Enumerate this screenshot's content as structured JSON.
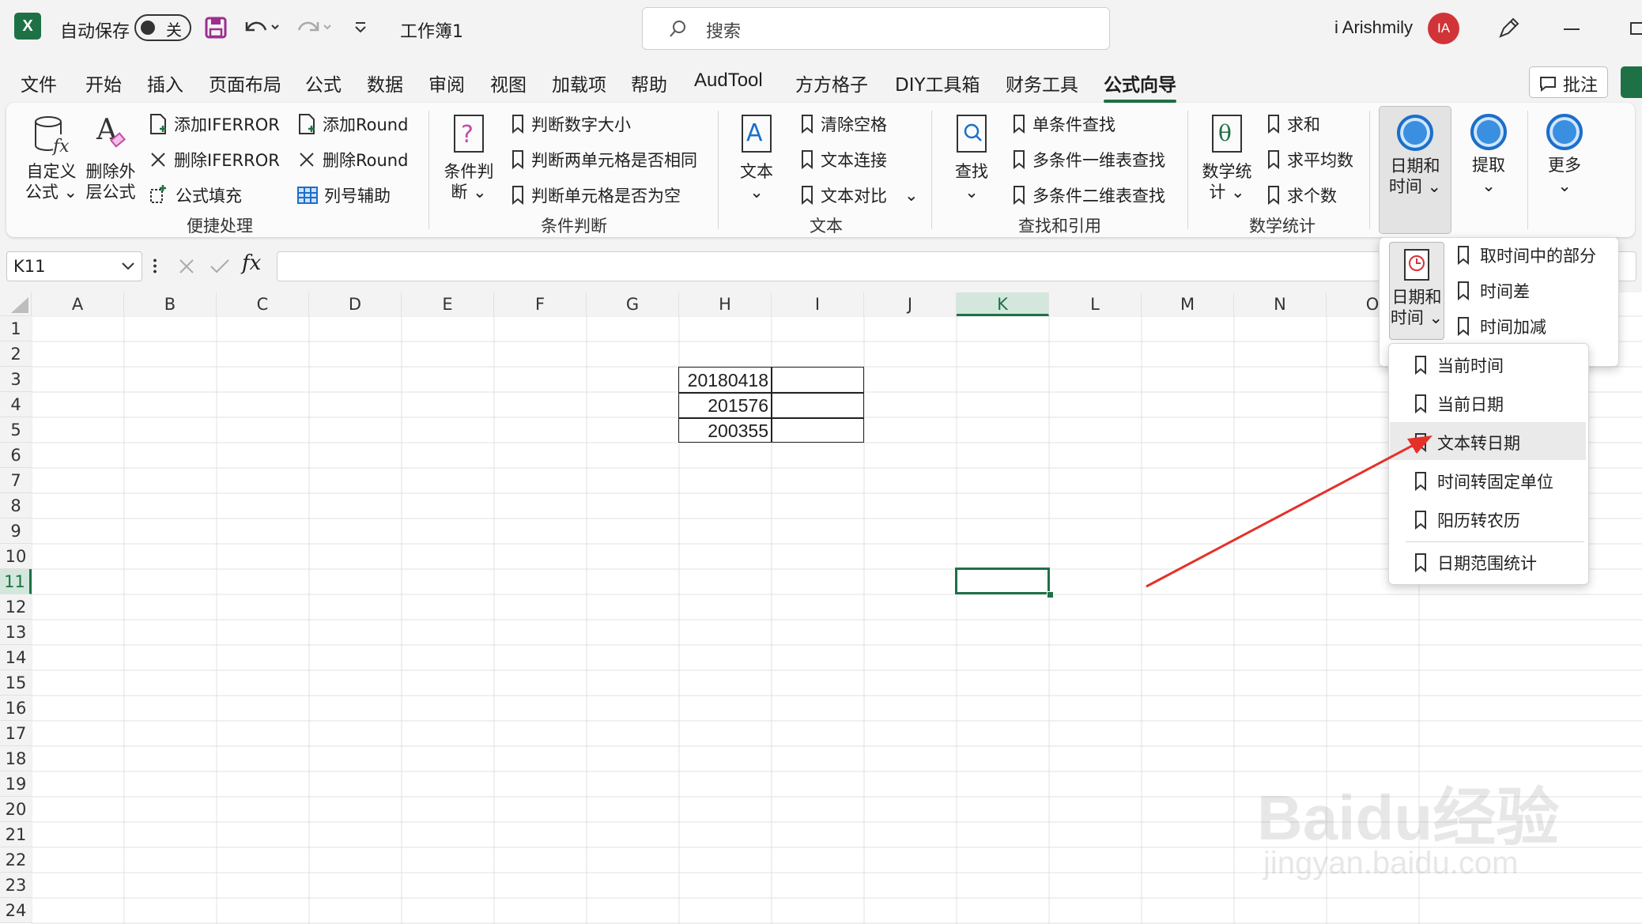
{
  "title_bar": {
    "autosave_label": "自动保存",
    "autosave_state": "关",
    "workbook_name": "工作簿1",
    "search_placeholder": "搜索",
    "user_name": "i Arishmily",
    "avatar_initials": "IA"
  },
  "menu": {
    "tabs": [
      "文件",
      "开始",
      "插入",
      "页面布局",
      "公式",
      "数据",
      "审阅",
      "视图",
      "加载项",
      "帮助",
      "AudTool",
      "方方格子",
      "DIY工具箱",
      "财务工具",
      "公式向导"
    ],
    "active_tab": "公式向导",
    "comment_button": "批注"
  },
  "ribbon": {
    "group1": {
      "label": "便捷处理",
      "custom_formula": [
        "自定义",
        "公式"
      ],
      "delete_outer": [
        "删除外",
        "层公式"
      ],
      "add_iferror": "添加IFERROR",
      "delete_iferror": "删除IFERROR",
      "formula_fill": "公式填充",
      "add_round": "添加Round",
      "delete_round": "删除Round",
      "column_helper": "列号辅助"
    },
    "group2": {
      "label": "条件判断",
      "big": [
        "条件判",
        "断"
      ],
      "items": [
        "判断数字大小",
        "判断两单元格是否相同",
        "判断单元格是否为空"
      ]
    },
    "group3": {
      "label": "文本",
      "big": "文本",
      "items": [
        "清除空格",
        "文本连接",
        "文本对比"
      ]
    },
    "group4": {
      "label": "查找和引用",
      "big": "查找",
      "items": [
        "单条件查找",
        "多条件一维表查找",
        "多条件二维表查找"
      ]
    },
    "group5": {
      "label": "数学统计",
      "big": [
        "数学统",
        "计"
      ],
      "items": [
        "求和",
        "求平均数",
        "求个数"
      ]
    },
    "group6": {
      "datetime": [
        "日期和",
        "时间"
      ],
      "extract": "提取",
      "more": "更多"
    }
  },
  "formula_bar": {
    "cell_ref": "K11",
    "fx": "fx"
  },
  "grid": {
    "columns": [
      "A",
      "B",
      "C",
      "D",
      "E",
      "F",
      "G",
      "H",
      "I",
      "J",
      "K",
      "L",
      "M",
      "N",
      "O"
    ],
    "rows": [
      "1",
      "2",
      "3",
      "4",
      "5",
      "6",
      "7",
      "8",
      "9",
      "10",
      "11",
      "12",
      "13",
      "14",
      "15",
      "16",
      "17",
      "18",
      "19",
      "20",
      "21",
      "22",
      "23",
      "24"
    ],
    "active_column": "K",
    "active_row": "11",
    "cells": {
      "H3": "20180418",
      "H4": "201576",
      "H5": "200355"
    }
  },
  "dropdown": {
    "button_label": [
      "日期和",
      "时间"
    ],
    "top_items": [
      "取时间中的部分",
      "时间差",
      "时间加减"
    ],
    "sub_items": [
      "当前时间",
      "当前日期",
      "文本转日期",
      "时间转固定单位",
      "阳历转农历"
    ],
    "hovered_item": "文本转日期",
    "bottom_item": "日期范围统计"
  },
  "watermark": {
    "brand": "Baidu经验",
    "url": "jingyan.baidu.com"
  },
  "colors": {
    "excel_green": "#1e7145",
    "annotation_arrow": "#e5302a",
    "avatar_red": "#d13438",
    "save_icon": "#9b2e8f"
  }
}
